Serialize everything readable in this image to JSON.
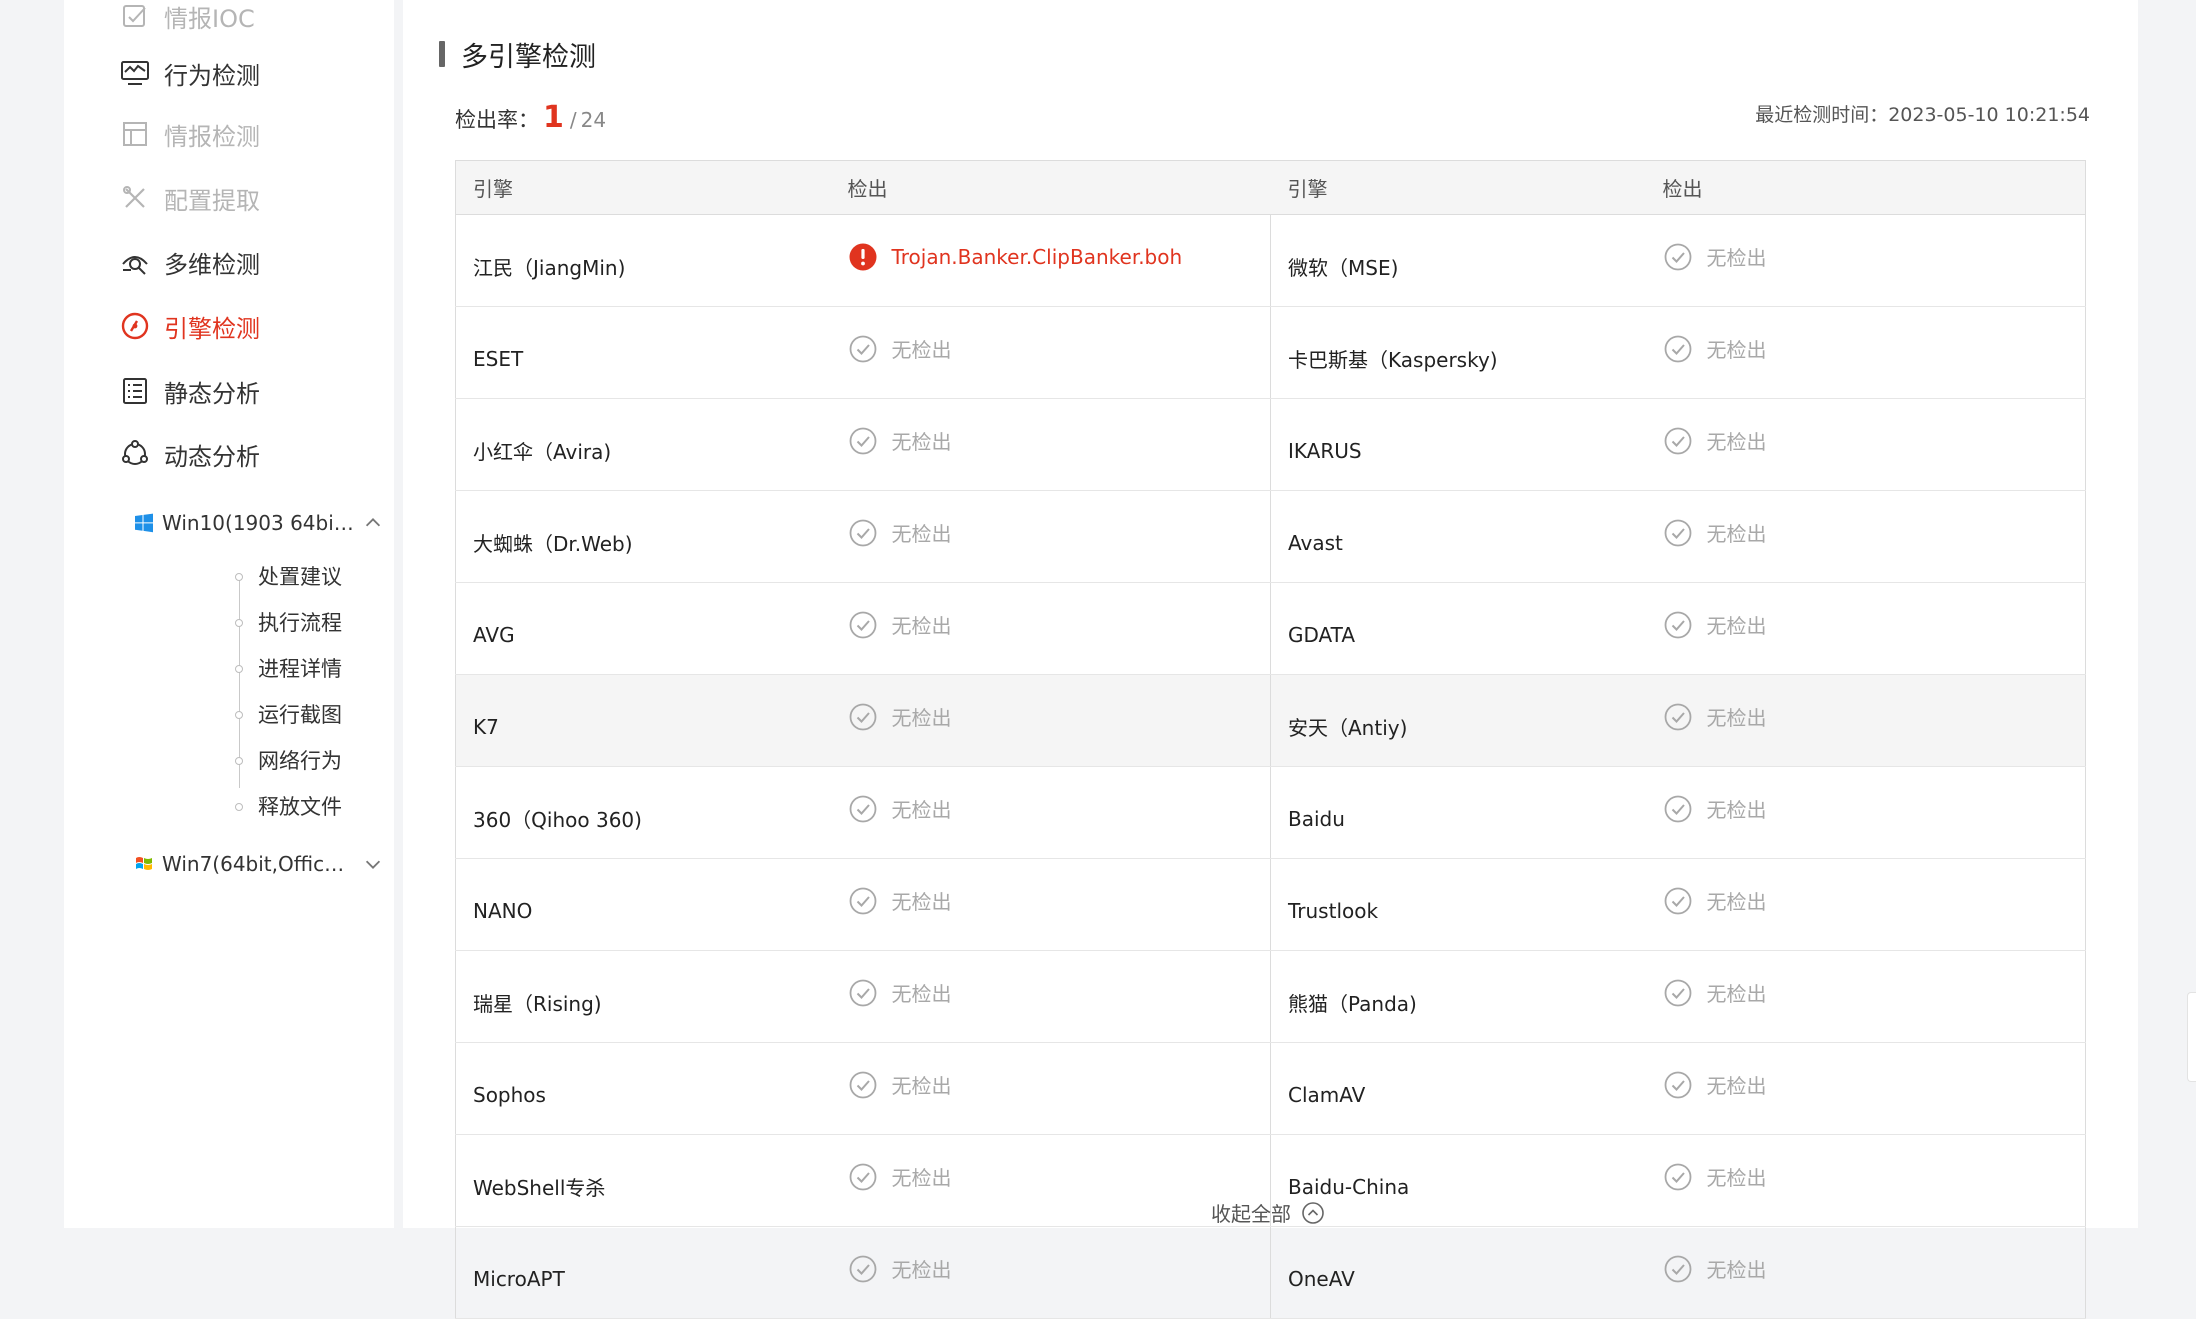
{
  "sidebar": {
    "nav": [
      {
        "label": "情报IOC",
        "icon": "intel-ioc-icon",
        "state": "disabled"
      },
      {
        "label": "行为检测",
        "icon": "behavior-monitor-icon",
        "state": "normal"
      },
      {
        "label": "情报检测",
        "icon": "intel-layout-icon",
        "state": "disabled"
      },
      {
        "label": "配置提取",
        "icon": "tools-icon",
        "state": "disabled"
      },
      {
        "label": "多维检测",
        "icon": "multi-dimension-icon",
        "state": "normal"
      },
      {
        "label": "引擎检测",
        "icon": "engine-gauge-icon",
        "state": "active"
      },
      {
        "label": "静态分析",
        "icon": "list-document-icon",
        "state": "normal"
      },
      {
        "label": "动态分析",
        "icon": "cycle-nodes-icon",
        "state": "normal"
      }
    ],
    "vms": [
      {
        "label": "Win10(1903 64bi…",
        "icon": "windows10-logo-icon",
        "expanded": true
      },
      {
        "label": "Win7(64bit,Office…",
        "icon": "windows7-logo-icon",
        "expanded": false
      }
    ],
    "sub_items": [
      "处置建议",
      "执行流程",
      "进程详情",
      "运行截图",
      "网络行为",
      "释放文件"
    ]
  },
  "main": {
    "section_title": "多引擎检测",
    "rate_label": "检出率：",
    "detected_count": "1",
    "separator": "/",
    "total_count": "24",
    "last_check_label": "最近检测时间：2023-05-10 10:21:54",
    "headers": [
      "引擎",
      "检出",
      "引擎",
      "检出"
    ],
    "rows": [
      {
        "left_engine": "江民（JiangMin)",
        "left_result": "Trojan.Banker.ClipBanker.boh",
        "left_detected": true,
        "right_engine": "微软（MSE)",
        "right_result": "无检出",
        "right_detected": false
      },
      {
        "left_engine": "ESET",
        "left_result": "无检出",
        "left_detected": false,
        "right_engine": "卡巴斯基（Kaspersky)",
        "right_result": "无检出",
        "right_detected": false
      },
      {
        "left_engine": "小红伞（Avira)",
        "left_result": "无检出",
        "left_detected": false,
        "right_engine": "IKARUS",
        "right_result": "无检出",
        "right_detected": false
      },
      {
        "left_engine": "大蜘蛛（Dr.Web)",
        "left_result": "无检出",
        "left_detected": false,
        "right_engine": "Avast",
        "right_result": "无检出",
        "right_detected": false
      },
      {
        "left_engine": "AVG",
        "left_result": "无检出",
        "left_detected": false,
        "right_engine": "GDATA",
        "right_result": "无检出",
        "right_detected": false
      },
      {
        "left_engine": "K7",
        "left_result": "无检出",
        "left_detected": false,
        "right_engine": "安天（Antiy)",
        "right_result": "无检出",
        "right_detected": false,
        "highlight": true
      },
      {
        "left_engine": "360（Qihoo 360)",
        "left_result": "无检出",
        "left_detected": false,
        "right_engine": "Baidu",
        "right_result": "无检出",
        "right_detected": false
      },
      {
        "left_engine": "NANO",
        "left_result": "无检出",
        "left_detected": false,
        "right_engine": "Trustlook",
        "right_result": "无检出",
        "right_detected": false
      },
      {
        "left_engine": "瑞星（Rising)",
        "left_result": "无检出",
        "left_detected": false,
        "right_engine": "熊猫（Panda)",
        "right_result": "无检出",
        "right_detected": false
      },
      {
        "left_engine": "Sophos",
        "left_result": "无检出",
        "left_detected": false,
        "right_engine": "ClamAV",
        "right_result": "无检出",
        "right_detected": false
      },
      {
        "left_engine": "WebShell专杀",
        "left_result": "无检出",
        "left_detected": false,
        "right_engine": "Baidu-China",
        "right_result": "无检出",
        "right_detected": false
      },
      {
        "left_engine": "MicroAPT",
        "left_result": "无检出",
        "left_detected": false,
        "right_engine": "OneAV",
        "right_result": "无检出",
        "right_detected": false
      }
    ],
    "collapse_label": "收起全部"
  },
  "colors": {
    "accent": "#e0341f",
    "muted": "#a8a8a8",
    "header_bg": "#f5f5f5"
  }
}
